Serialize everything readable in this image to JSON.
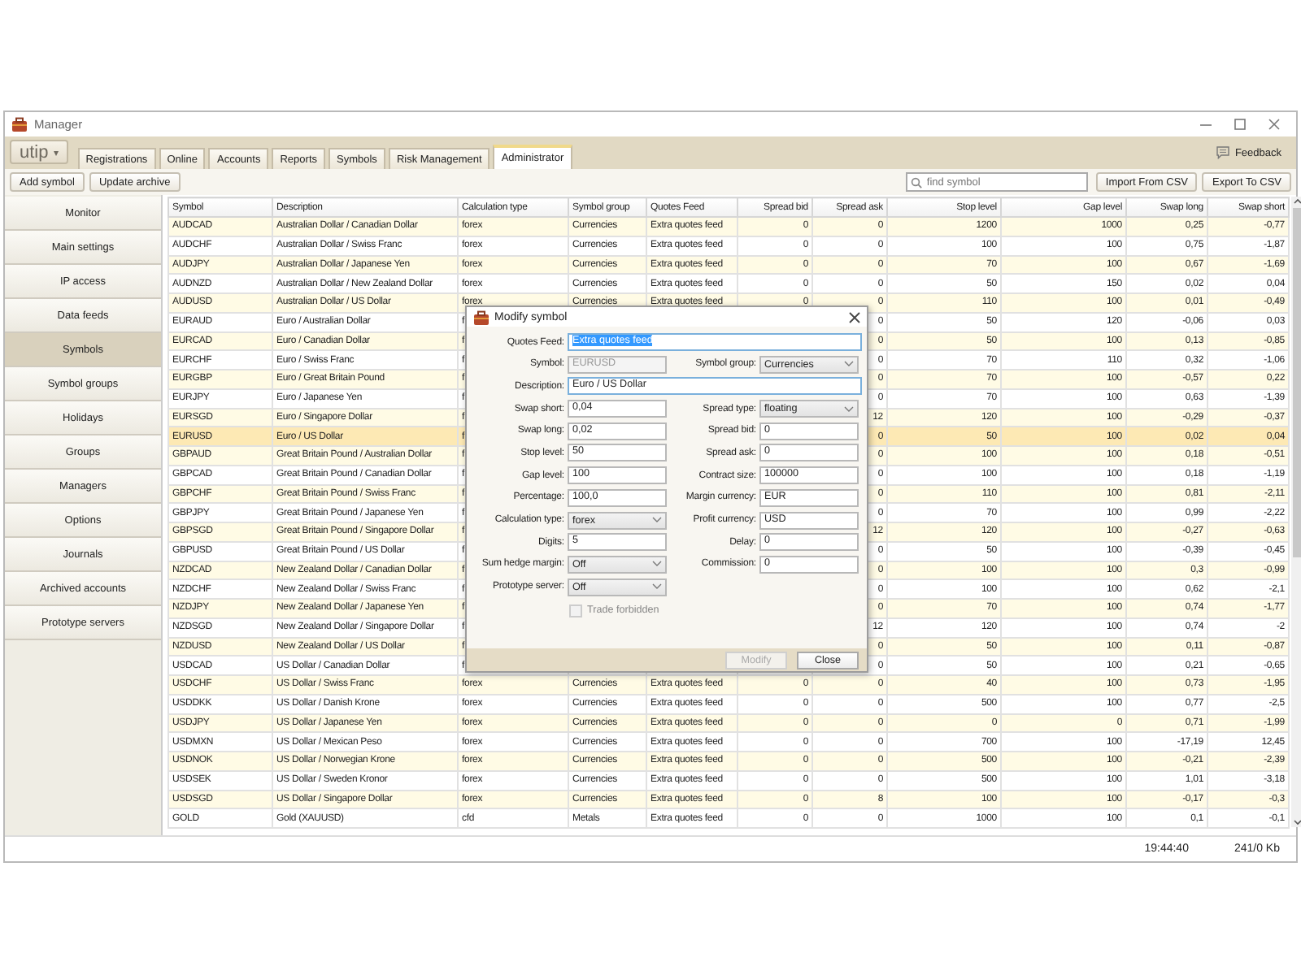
{
  "window": {
    "title": "Manager"
  },
  "logo": {
    "label": "utip",
    "caret": "▾"
  },
  "tabs": [
    {
      "label": "Registrations",
      "selected": false
    },
    {
      "label": "Online",
      "selected": false
    },
    {
      "label": "Accounts",
      "selected": false
    },
    {
      "label": "Reports",
      "selected": false
    },
    {
      "label": "Symbols",
      "selected": false
    },
    {
      "label": "Risk Management",
      "selected": false
    },
    {
      "label": "Administrator",
      "selected": true
    }
  ],
  "feedback": {
    "label": "Feedback"
  },
  "toolbar": {
    "buttons": [
      "Add symbol",
      "Update archive"
    ],
    "search": {
      "placeholder": "find symbol"
    },
    "right_buttons": [
      "Import From CSV",
      "Export To CSV"
    ]
  },
  "sidebar": {
    "items": [
      {
        "label": "Monitor",
        "selected": false
      },
      {
        "label": "Main settings",
        "selected": false
      },
      {
        "label": "IP access",
        "selected": false
      },
      {
        "label": "Data feeds",
        "selected": false
      },
      {
        "label": "Symbols",
        "selected": true
      },
      {
        "label": "Symbol groups",
        "selected": false
      },
      {
        "label": "Holidays",
        "selected": false
      },
      {
        "label": "Groups",
        "selected": false
      },
      {
        "label": "Managers",
        "selected": false
      },
      {
        "label": "Options",
        "selected": false
      },
      {
        "label": "Journals",
        "selected": false
      },
      {
        "label": "Archived accounts",
        "selected": false
      },
      {
        "label": "Prototype servers",
        "selected": false
      }
    ]
  },
  "table": {
    "columns": [
      "Symbol",
      "Description",
      "Calculation type",
      "Symbol group",
      "Quotes Feed",
      "Spread bid",
      "Spread ask",
      "Stop level",
      "Gap level",
      "Swap long",
      "Swap short"
    ],
    "rows": [
      {
        "selected": false,
        "symbol": "AUDCAD",
        "description": "Australian Dollar / Canadian Dollar",
        "calculation_type": "forex",
        "symbol_group": "Currencies",
        "quotes_feed": "Extra quotes feed",
        "spread_bid": "0",
        "spread_ask": "0",
        "stop_level": "1200",
        "gap_level": "1000",
        "swap_long": "0,25",
        "swap_short": "-0,77"
      },
      {
        "selected": false,
        "symbol": "AUDCHF",
        "description": "Australian Dollar / Swiss Franc",
        "calculation_type": "forex",
        "symbol_group": "Currencies",
        "quotes_feed": "Extra quotes feed",
        "spread_bid": "0",
        "spread_ask": "0",
        "stop_level": "100",
        "gap_level": "100",
        "swap_long": "0,75",
        "swap_short": "-1,87"
      },
      {
        "selected": false,
        "symbol": "AUDJPY",
        "description": "Australian Dollar / Japanese Yen",
        "calculation_type": "forex",
        "symbol_group": "Currencies",
        "quotes_feed": "Extra quotes feed",
        "spread_bid": "0",
        "spread_ask": "0",
        "stop_level": "70",
        "gap_level": "100",
        "swap_long": "0,67",
        "swap_short": "-1,69"
      },
      {
        "selected": false,
        "symbol": "AUDNZD",
        "description": "Australian Dollar / New Zealand Dollar",
        "calculation_type": "forex",
        "symbol_group": "Currencies",
        "quotes_feed": "Extra quotes feed",
        "spread_bid": "0",
        "spread_ask": "0",
        "stop_level": "50",
        "gap_level": "150",
        "swap_long": "0,02",
        "swap_short": "0,04"
      },
      {
        "selected": false,
        "symbol": "AUDUSD",
        "description": "Australian Dollar / US Dollar",
        "calculation_type": "forex",
        "symbol_group": "Currencies",
        "quotes_feed": "Extra quotes feed",
        "spread_bid": "0",
        "spread_ask": "0",
        "stop_level": "110",
        "gap_level": "100",
        "swap_long": "0,01",
        "swap_short": "-0,49"
      },
      {
        "selected": false,
        "symbol": "EURAUD",
        "description": "Euro / Australian Dollar",
        "calculation_type": "f",
        "spread_ask": "0",
        "stop_level": "50",
        "gap_level": "120",
        "swap_long": "-0,06",
        "swap_short": "0,03"
      },
      {
        "selected": false,
        "symbol": "EURCAD",
        "description": "Euro / Canadian Dollar",
        "calculation_type": "f",
        "spread_ask": "0",
        "stop_level": "50",
        "gap_level": "100",
        "swap_long": "0,13",
        "swap_short": "-0,85"
      },
      {
        "selected": false,
        "symbol": "EURCHF",
        "description": "Euro / Swiss Franc",
        "calculation_type": "f",
        "spread_ask": "0",
        "stop_level": "70",
        "gap_level": "110",
        "swap_long": "0,32",
        "swap_short": "-1,06"
      },
      {
        "selected": false,
        "symbol": "EURGBP",
        "description": "Euro / Great Britain Pound",
        "calculation_type": "f",
        "spread_ask": "0",
        "stop_level": "70",
        "gap_level": "100",
        "swap_long": "-0,57",
        "swap_short": "0,22"
      },
      {
        "selected": false,
        "symbol": "EURJPY",
        "description": "Euro / Japanese Yen",
        "calculation_type": "f",
        "spread_ask": "0",
        "stop_level": "70",
        "gap_level": "100",
        "swap_long": "0,63",
        "swap_short": "-1,39"
      },
      {
        "selected": false,
        "symbol": "EURSGD",
        "description": "Euro / Singapore Dollar",
        "calculation_type": "f",
        "spread_ask": "12",
        "stop_level": "120",
        "gap_level": "100",
        "swap_long": "-0,29",
        "swap_short": "-0,37"
      },
      {
        "selected": true,
        "symbol": "EURUSD",
        "description": "Euro / US Dollar",
        "calculation_type": "f",
        "spread_ask": "0",
        "stop_level": "50",
        "gap_level": "100",
        "swap_long": "0,02",
        "swap_short": "0,04"
      },
      {
        "selected": false,
        "symbol": "GBPAUD",
        "description": "Great Britain Pound / Australian Dollar",
        "calculation_type": "f",
        "spread_ask": "0",
        "stop_level": "100",
        "gap_level": "100",
        "swap_long": "0,18",
        "swap_short": "-0,51"
      },
      {
        "selected": false,
        "symbol": "GBPCAD",
        "description": "Great Britain Pound / Canadian Dollar",
        "calculation_type": "f",
        "spread_ask": "0",
        "stop_level": "100",
        "gap_level": "100",
        "swap_long": "0,18",
        "swap_short": "-1,19"
      },
      {
        "selected": false,
        "symbol": "GBPCHF",
        "description": "Great Britain Pound / Swiss Franc",
        "calculation_type": "f",
        "spread_ask": "0",
        "stop_level": "110",
        "gap_level": "100",
        "swap_long": "0,81",
        "swap_short": "-2,11"
      },
      {
        "selected": false,
        "symbol": "GBPJPY",
        "description": "Great Britain Pound / Japanese Yen",
        "calculation_type": "f",
        "spread_ask": "0",
        "stop_level": "70",
        "gap_level": "100",
        "swap_long": "0,99",
        "swap_short": "-2,22"
      },
      {
        "selected": false,
        "symbol": "GBPSGD",
        "description": "Great Britain Pound / Singapore Dollar",
        "calculation_type": "f",
        "spread_ask": "12",
        "stop_level": "120",
        "gap_level": "100",
        "swap_long": "-0,27",
        "swap_short": "-0,63"
      },
      {
        "selected": false,
        "symbol": "GBPUSD",
        "description": "Great Britain Pound / US Dollar",
        "calculation_type": "f",
        "spread_ask": "0",
        "stop_level": "50",
        "gap_level": "100",
        "swap_long": "-0,39",
        "swap_short": "-0,45"
      },
      {
        "selected": false,
        "symbol": "NZDCAD",
        "description": "New Zealand Dollar / Canadian Dollar",
        "calculation_type": "f",
        "spread_ask": "0",
        "stop_level": "100",
        "gap_level": "100",
        "swap_long": "0,3",
        "swap_short": "-0,99"
      },
      {
        "selected": false,
        "symbol": "NZDCHF",
        "description": "New Zealand Dollar / Swiss Franc",
        "calculation_type": "f",
        "spread_ask": "0",
        "stop_level": "100",
        "gap_level": "100",
        "swap_long": "0,62",
        "swap_short": "-2,1"
      },
      {
        "selected": false,
        "symbol": "NZDJPY",
        "description": "New Zealand Dollar / Japanese Yen",
        "calculation_type": "f",
        "spread_ask": "0",
        "stop_level": "70",
        "gap_level": "100",
        "swap_long": "0,74",
        "swap_short": "-1,77"
      },
      {
        "selected": false,
        "symbol": "NZDSGD",
        "description": "New Zealand Dollar / Singapore Dollar",
        "calculation_type": "f",
        "spread_ask": "12",
        "stop_level": "120",
        "gap_level": "100",
        "swap_long": "0,74",
        "swap_short": "-2"
      },
      {
        "selected": false,
        "symbol": "NZDUSD",
        "description": "New Zealand Dollar / US Dollar",
        "calculation_type": "f",
        "spread_ask": "0",
        "stop_level": "50",
        "gap_level": "100",
        "swap_long": "0,11",
        "swap_short": "-0,87"
      },
      {
        "selected": false,
        "symbol": "USDCAD",
        "description": "US Dollar / Canadian Dollar",
        "calculation_type": "f",
        "spread_ask": "0",
        "stop_level": "50",
        "gap_level": "100",
        "swap_long": "0,21",
        "swap_short": "-0,65"
      },
      {
        "selected": false,
        "symbol": "USDCHF",
        "description": "US Dollar / Swiss Franc",
        "calculation_type": "forex",
        "symbol_group": "Currencies",
        "quotes_feed": "Extra quotes feed",
        "spread_bid": "0",
        "spread_ask": "0",
        "stop_level": "40",
        "gap_level": "100",
        "swap_long": "0,73",
        "swap_short": "-1,95"
      },
      {
        "selected": false,
        "symbol": "USDDKK",
        "description": "US Dollar / Danish Krone",
        "calculation_type": "forex",
        "symbol_group": "Currencies",
        "quotes_feed": "Extra quotes feed",
        "spread_bid": "0",
        "spread_ask": "0",
        "stop_level": "500",
        "gap_level": "100",
        "swap_long": "0,77",
        "swap_short": "-2,5"
      },
      {
        "selected": false,
        "symbol": "USDJPY",
        "description": "US Dollar / Japanese Yen",
        "calculation_type": "forex",
        "symbol_group": "Currencies",
        "quotes_feed": "Extra quotes feed",
        "spread_bid": "0",
        "spread_ask": "0",
        "stop_level": "0",
        "gap_level": "0",
        "swap_long": "0,71",
        "swap_short": "-1,99"
      },
      {
        "selected": false,
        "symbol": "USDMXN",
        "description": "US Dollar / Mexican Peso",
        "calculation_type": "forex",
        "symbol_group": "Currencies",
        "quotes_feed": "Extra quotes feed",
        "spread_bid": "0",
        "spread_ask": "0",
        "stop_level": "700",
        "gap_level": "100",
        "swap_long": "-17,19",
        "swap_short": "12,45"
      },
      {
        "selected": false,
        "symbol": "USDNOK",
        "description": "US Dollar / Norwegian Krone",
        "calculation_type": "forex",
        "symbol_group": "Currencies",
        "quotes_feed": "Extra quotes feed",
        "spread_bid": "0",
        "spread_ask": "0",
        "stop_level": "500",
        "gap_level": "100",
        "swap_long": "-0,21",
        "swap_short": "-2,39"
      },
      {
        "selected": false,
        "symbol": "USDSEK",
        "description": "US Dollar / Sweden Kronor",
        "calculation_type": "forex",
        "symbol_group": "Currencies",
        "quotes_feed": "Extra quotes feed",
        "spread_bid": "0",
        "spread_ask": "0",
        "stop_level": "500",
        "gap_level": "100",
        "swap_long": "1,01",
        "swap_short": "-3,18"
      },
      {
        "selected": false,
        "symbol": "USDSGD",
        "description": "US Dollar / Singapore Dollar",
        "calculation_type": "forex",
        "symbol_group": "Currencies",
        "quotes_feed": "Extra quotes feed",
        "spread_bid": "0",
        "spread_ask": "8",
        "stop_level": "100",
        "gap_level": "100",
        "swap_long": "-0,17",
        "swap_short": "-0,3"
      },
      {
        "selected": false,
        "symbol": "GOLD",
        "description": "Gold (XAUUSD)",
        "calculation_type": "cfd",
        "symbol_group": "Metals",
        "quotes_feed": "Extra quotes feed",
        "spread_bid": "0",
        "spread_ask": "0",
        "stop_level": "1000",
        "gap_level": "100",
        "swap_long": "0,1",
        "swap_short": "-0,1"
      }
    ]
  },
  "dialog": {
    "title": "Modify symbol",
    "fields": [
      {
        "kind": "wide",
        "label": "Quotes Feed:",
        "value": "Extra quotes feed",
        "text_selected": true
      },
      {
        "kind": "readonly",
        "label": "Symbol:",
        "value": "EURUSD"
      },
      {
        "kind": "select",
        "label": "Symbol group:",
        "value": "Currencies"
      },
      {
        "kind": "wide",
        "label": "Description:",
        "value": "Euro / US Dollar",
        "text_selected": false
      },
      {
        "kind": "text",
        "label": "Swap short:",
        "value": "0,04"
      },
      {
        "kind": "select",
        "label": "Spread type:",
        "value": "floating"
      },
      {
        "kind": "text",
        "label": "Swap long:",
        "value": "0,02"
      },
      {
        "kind": "text",
        "label": "Spread bid:",
        "value": "0"
      },
      {
        "kind": "text",
        "label": "Stop level:",
        "value": "50"
      },
      {
        "kind": "text",
        "label": "Spread ask:",
        "value": "0"
      },
      {
        "kind": "text",
        "label": "Gap level:",
        "value": "100"
      },
      {
        "kind": "text",
        "label": "Contract size:",
        "value": "100000"
      },
      {
        "kind": "text",
        "label": "Percentage:",
        "value": "100,0"
      },
      {
        "kind": "text",
        "label": "Margin currency:",
        "value": "EUR"
      },
      {
        "kind": "select",
        "label": "Calculation type:",
        "value": "forex"
      },
      {
        "kind": "text",
        "label": "Profit currency:",
        "value": "USD"
      },
      {
        "kind": "text",
        "label": "Digits:",
        "value": "5"
      },
      {
        "kind": "text",
        "label": "Delay:",
        "value": "0"
      },
      {
        "kind": "select",
        "label": "Sum hedge margin:",
        "value": "Off"
      },
      {
        "kind": "text",
        "label": "Commission:",
        "value": "0"
      },
      {
        "kind": "select",
        "label": "Prototype server:",
        "value": "Off"
      }
    ],
    "checkbox": {
      "label": "Trade forbidden",
      "checked": false,
      "disabled": true
    },
    "buttons": [
      {
        "label": "Modify",
        "disabled": true
      },
      {
        "label": "Close",
        "disabled": false
      }
    ]
  },
  "status_bar": {
    "time": "19:44:40",
    "traffic": "241/0 Kb"
  }
}
